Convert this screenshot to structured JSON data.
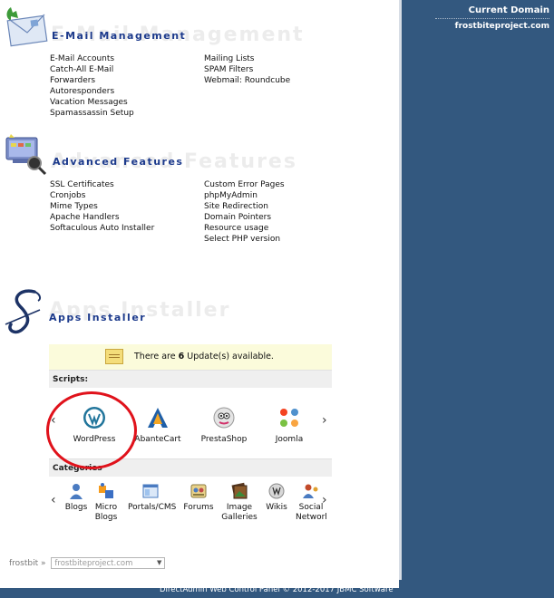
{
  "sidebar": {
    "current_domain_title": "Current Domain",
    "current_domain": "frostbiteproject.com"
  },
  "email": {
    "watermark": "E-Mail Management",
    "title": "E-Mail Management",
    "col1": [
      "E-Mail Accounts",
      "Catch-All E-Mail",
      "Forwarders",
      "Autoresponders",
      "Vacation Messages",
      "Spamassassin Setup"
    ],
    "col2": [
      "Mailing Lists",
      "SPAM Filters",
      "Webmail: Roundcube"
    ]
  },
  "advanced": {
    "watermark": "Advanced Features",
    "title": "Advanced Features",
    "col1": [
      "SSL Certificates",
      "Cronjobs",
      "Mime Types",
      "Apache Handlers",
      "Softaculous Auto Installer"
    ],
    "col2": [
      "Custom Error Pages",
      "phpMyAdmin",
      "Site Redirection",
      "Domain Pointers",
      "Resource usage",
      "Select PHP version"
    ]
  },
  "apps": {
    "watermark": "Apps Installer",
    "title": "Apps Installer",
    "notice_pre": "There are ",
    "notice_count": "6",
    "notice_post": " Update(s) available.",
    "note_icon_label": "NOTE",
    "scripts_label": "Scripts:",
    "scripts": [
      "WordPress",
      "AbanteCart",
      "PrestaShop",
      "Joomla"
    ],
    "categories_label": "Categories",
    "categories": [
      "Blogs",
      "Micro Blogs",
      "Portals/CMS",
      "Forums",
      "Image Galleries",
      "Wikis",
      "Social Networking"
    ],
    "prev_arrow": "‹",
    "next_arrow": "›"
  },
  "domain_selector": {
    "user": "frostbit",
    "separator": "»",
    "selected": "frostbiteproject.com"
  },
  "footer": {
    "text": "DirectAdmin Web Control Panel © 2012-2017 JBMC Software"
  },
  "colors": {
    "sidebar_bg": "#33587f",
    "section_title": "#1c3a8c",
    "highlight_circle": "#e0121b",
    "notice_bg": "#fbfbdb"
  }
}
